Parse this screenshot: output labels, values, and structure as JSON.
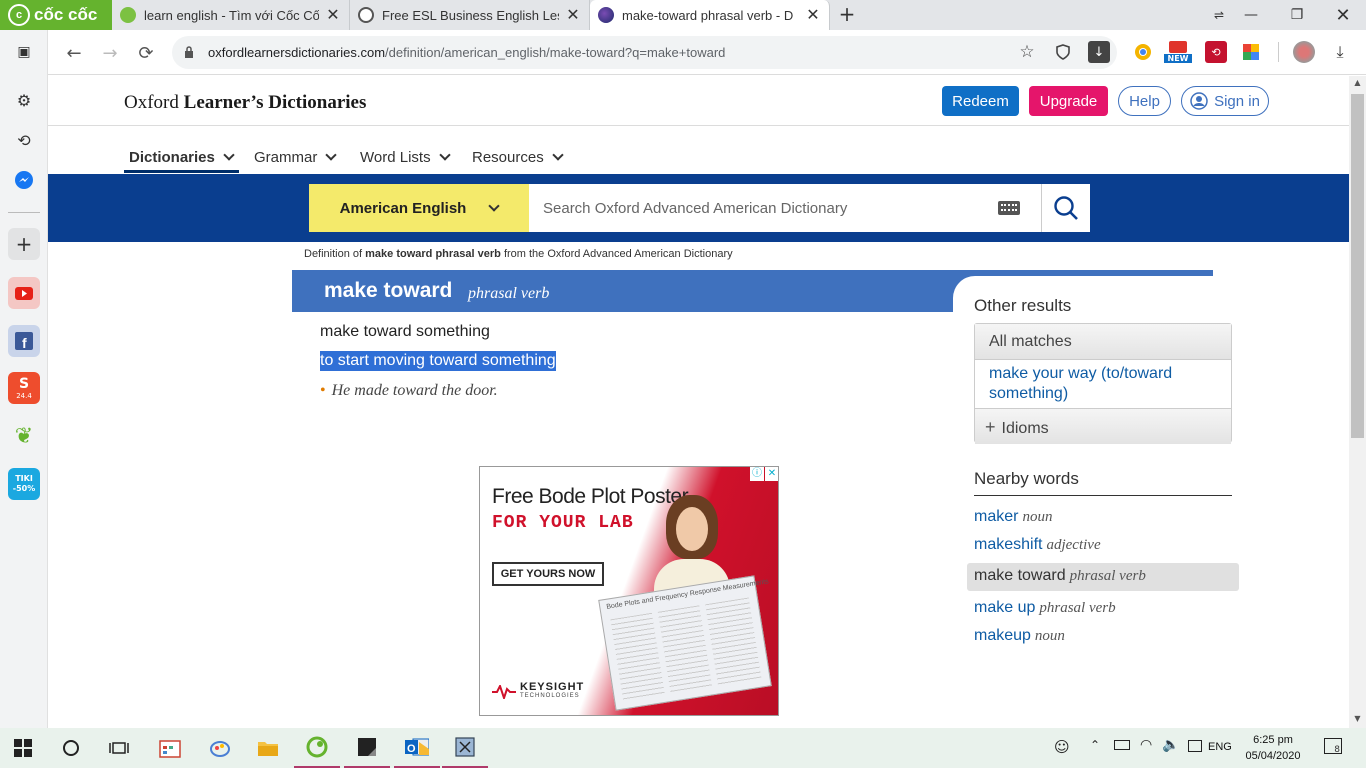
{
  "browser": {
    "brand": "cốc cốc",
    "tabs": [
      {
        "title": "learn english - Tìm với Cốc Cốc"
      },
      {
        "title": "Free ESL Business English Less"
      },
      {
        "title": "make-toward phrasal verb - D"
      }
    ],
    "url_host": "oxfordlearnersdictionaries.com",
    "url_path": "/definition/american_english/make-toward?q=make+toward",
    "new_badge": "NEW"
  },
  "sidebar": {
    "tiki_label": "TIKI -50%",
    "shopee_label": "24.4"
  },
  "header": {
    "logo_regular": "Oxford ",
    "logo_bold": "Learner’s Dictionaries",
    "redeem": "Redeem",
    "upgrade": "Upgrade",
    "help": "Help",
    "signin": "Sign in"
  },
  "menu": [
    "Dictionaries",
    "Grammar",
    "Word Lists",
    "Resources"
  ],
  "search": {
    "dictionary": "American English",
    "placeholder": "Search Oxford Advanced American Dictionary"
  },
  "entry": {
    "source_prefix": "Definition of ",
    "source_bold": "make toward phrasal verb",
    "source_suffix": " from the Oxford Advanced American Dictionary",
    "headword": "make toward",
    "pos": "phrasal verb",
    "sense_head": "make toward something",
    "definition": "to start moving toward something",
    "example": "He made toward the door."
  },
  "ad": {
    "line1": "Free Bode Plot Poster",
    "line2": "FOR YOUR LAB",
    "cta": "GET YOURS NOW",
    "brand": "KEYSIGHT",
    "brand_sub": "TECHNOLOGIES",
    "poster_title": "Bode Plots and Frequency Response Measurements"
  },
  "other_results": {
    "heading": "Other results",
    "all_matches": "All matches",
    "result": "make your way (to/toward something)",
    "idioms": "Idioms"
  },
  "nearby": {
    "heading": "Nearby words",
    "items": [
      {
        "word": "maker",
        "pos": "noun"
      },
      {
        "word": "makeshift",
        "pos": "adjective"
      },
      {
        "word": "make toward",
        "pos": "phrasal verb"
      },
      {
        "word": "make up",
        "pos": "phrasal verb"
      },
      {
        "word": "makeup",
        "pos": "noun"
      }
    ]
  },
  "taskbar": {
    "time": "6:25 pm",
    "date": "05/04/2020",
    "lang": "ENG",
    "notif": "8"
  },
  "colors": {
    "oxford_blue": "#0a3e8f",
    "headword_bar": "#3f71be",
    "redeem": "#0f6fc6",
    "upgrade": "#e5156b",
    "dict_yellow": "#f4ea6b",
    "link": "#0f5ca4"
  }
}
